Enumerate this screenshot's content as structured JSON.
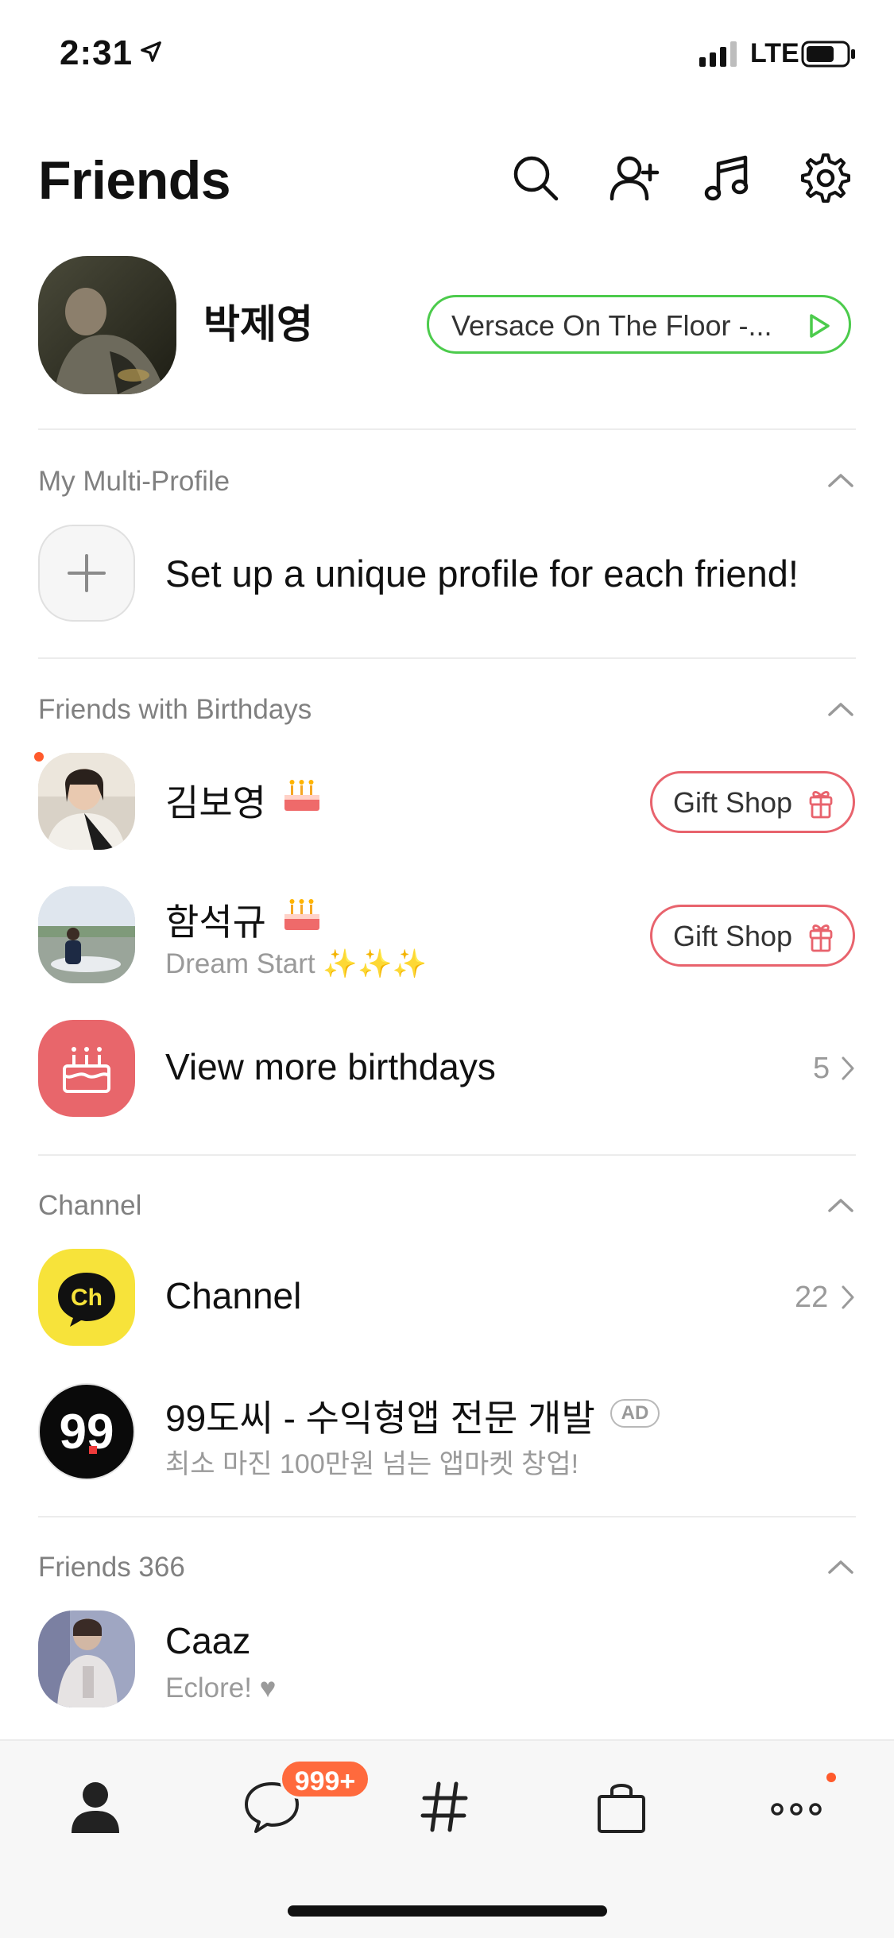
{
  "status_bar": {
    "time": "2:31",
    "network": "LTE"
  },
  "header": {
    "title": "Friends"
  },
  "my_profile": {
    "name": "박제영",
    "music": "Versace On The Floor -..."
  },
  "multi_profile": {
    "title": "My Multi-Profile",
    "prompt": "Set up a unique profile for each friend!"
  },
  "birthdays": {
    "title": "Friends with Birthdays",
    "friends": [
      {
        "name": "김보영",
        "status": "",
        "button": "Gift Shop"
      },
      {
        "name": "함석규",
        "status": "Dream Start ✨✨✨",
        "button": "Gift Shop"
      }
    ],
    "more_label": "View more birthdays",
    "more_count": "5"
  },
  "channel": {
    "title": "Channel",
    "item_label": "Channel",
    "item_count": "22",
    "ad": {
      "name": "99도씨 - 수익형앱 전문 개발",
      "badge": "AD",
      "desc": "최소 마진 100만원 넘는 앱마켓 창업!",
      "logo_text": "99"
    }
  },
  "friends": {
    "title": "Friends 366",
    "items": [
      {
        "name": "Caaz",
        "status": "Eclore! ♥"
      }
    ]
  },
  "tabbar": {
    "chat_badge": "999+"
  },
  "colors": {
    "accent_green": "#4ccb4c",
    "gift_red": "#e8636d",
    "badge_orange": "#ff6a3d",
    "channel_yellow": "#f7e33a"
  }
}
